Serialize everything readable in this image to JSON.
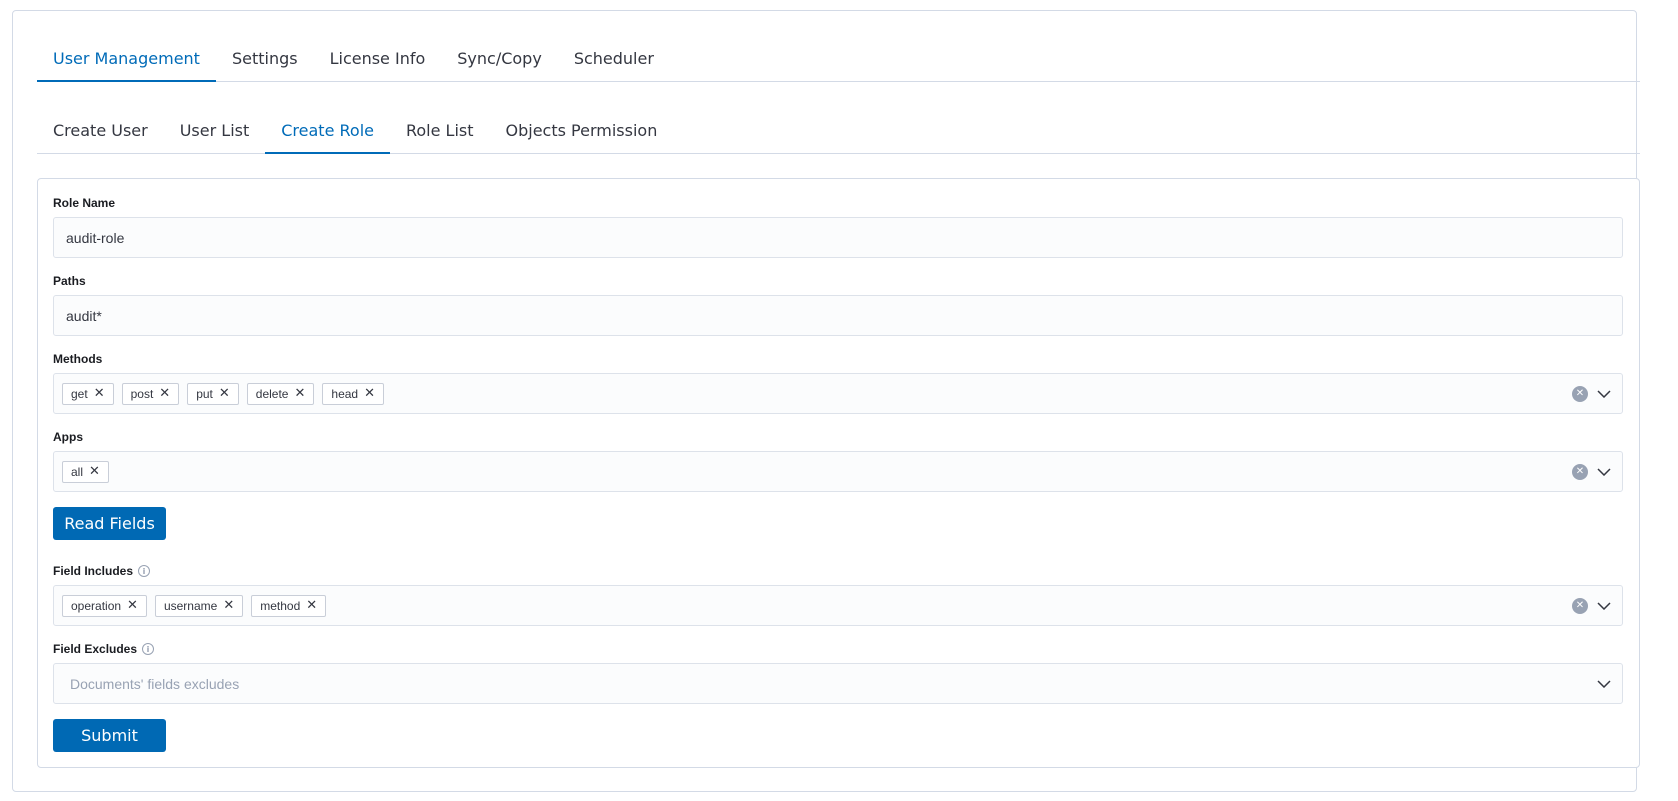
{
  "main_tabs": [
    {
      "label": "User Management",
      "selected": true
    },
    {
      "label": "Settings",
      "selected": false
    },
    {
      "label": "License Info",
      "selected": false
    },
    {
      "label": "Sync/Copy",
      "selected": false
    },
    {
      "label": "Scheduler",
      "selected": false
    }
  ],
  "sub_tabs": [
    {
      "label": "Create User",
      "selected": false
    },
    {
      "label": "User List",
      "selected": false
    },
    {
      "label": "Create Role",
      "selected": true
    },
    {
      "label": "Role List",
      "selected": false
    },
    {
      "label": "Objects Permission",
      "selected": false
    }
  ],
  "form": {
    "role_name": {
      "label": "Role Name",
      "value": "audit-role"
    },
    "paths": {
      "label": "Paths",
      "value": "audit*"
    },
    "methods": {
      "label": "Methods",
      "selected": [
        "get",
        "post",
        "put",
        "delete",
        "head"
      ]
    },
    "apps": {
      "label": "Apps",
      "selected": [
        "all"
      ]
    },
    "read_fields_button": "Read Fields",
    "field_includes": {
      "label": "Field Includes",
      "selected": [
        "operation",
        "username",
        "method"
      ]
    },
    "field_excludes": {
      "label": "Field Excludes",
      "placeholder": "Documents' fields excludes"
    },
    "submit_button": "Submit"
  },
  "icons": {
    "pill_remove": "cross-icon",
    "clear": "clear-circle-icon",
    "dropdown": "chevron-down-icon",
    "info": "info-icon"
  },
  "colors": {
    "accent": "#006bb8",
    "button": "#0069b4",
    "border": "#d3dae6",
    "field_bg": "#fbfcfd"
  }
}
